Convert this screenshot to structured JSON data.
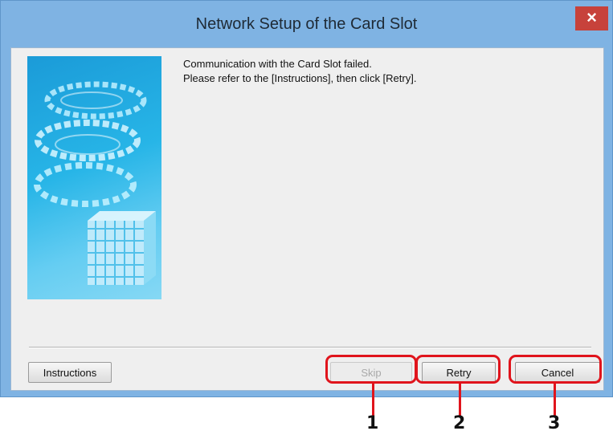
{
  "window": {
    "title": "Network Setup of the Card Slot",
    "close_symbol": "×"
  },
  "message": {
    "line1": "Communication with the Card Slot failed.",
    "line2": "Please refer to the [Instructions], then click [Retry]."
  },
  "buttons": {
    "instructions": "Instructions",
    "skip": "Skip",
    "retry": "Retry",
    "cancel": "Cancel"
  },
  "callouts": {
    "one": "1",
    "two": "2",
    "three": "3"
  },
  "colors": {
    "title_bar": "#7fb3e3",
    "close_button": "#c7423b",
    "callout_red": "#e0141c",
    "dialog_bg": "#efefef"
  }
}
